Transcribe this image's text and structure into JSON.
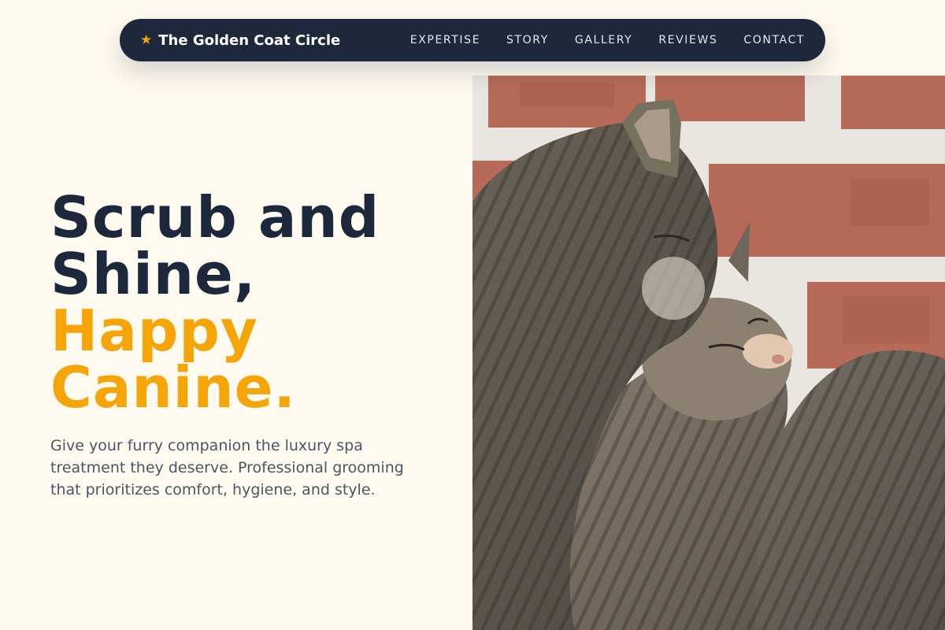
{
  "nav": {
    "brand_icon": "star-icon",
    "brand_name": "The Golden Coat Circle",
    "links": [
      "EXPERTISE",
      "STORY",
      "GALLERY",
      "REVIEWS",
      "CONTACT"
    ]
  },
  "hero": {
    "title_line1": "Scrub and",
    "title_line2": "Shine,",
    "title_line3": "Happy",
    "title_line4": "Canine.",
    "subtitle": "Give your furry companion the luxury spa treatment they deserve. Professional grooming that prioritizes comfort, hygiene, and style."
  },
  "image": {
    "description": "two-tabby-cats-photo"
  },
  "colors": {
    "navy": "#1e283d",
    "accent": "#f5a507",
    "background": "#fefaef"
  }
}
